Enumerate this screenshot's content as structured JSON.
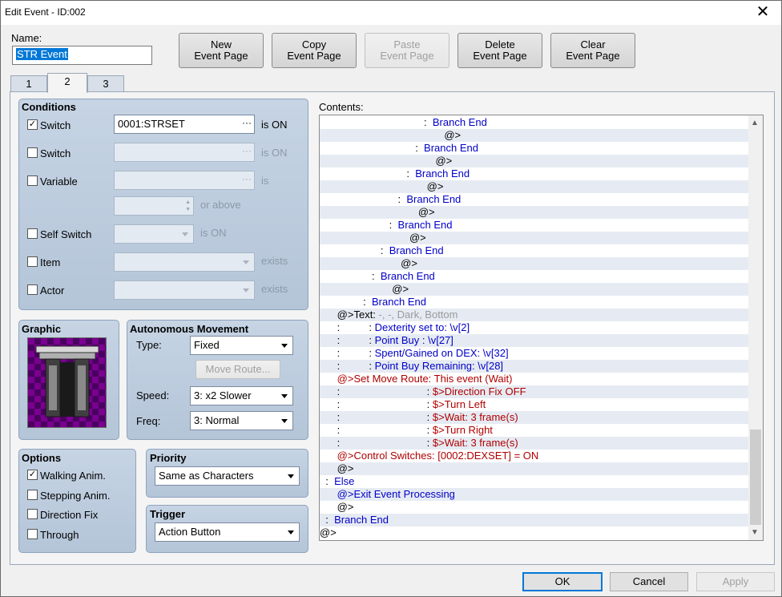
{
  "window": {
    "title": "Edit Event - ID:002",
    "close_glyph": "✕"
  },
  "name": {
    "label": "Name:",
    "value": "STR Event"
  },
  "toolbar": {
    "new_page_1": "New",
    "new_page_2": "Event Page",
    "copy_page_1": "Copy",
    "copy_page_2": "Event Page",
    "paste_page_1": "Paste",
    "paste_page_2": "Event Page",
    "delete_page_1": "Delete",
    "delete_page_2": "Event Page",
    "clear_page_1": "Clear",
    "clear_page_2": "Event Page"
  },
  "tabs": [
    {
      "label": "1"
    },
    {
      "label": "2"
    },
    {
      "label": "3"
    }
  ],
  "conditions": {
    "title": "Conditions",
    "switch1": {
      "label": "Switch",
      "checked": true,
      "value": "0001:STRSET",
      "suffix": "is ON"
    },
    "switch2": {
      "label": "Switch",
      "checked": false,
      "value": "",
      "suffix": "is ON"
    },
    "variable": {
      "label": "Variable",
      "checked": false,
      "value": "",
      "suffix": "is",
      "or_above": "or above"
    },
    "self_switch": {
      "label": "Self Switch",
      "checked": false,
      "suffix": "is ON"
    },
    "item": {
      "label": "Item",
      "checked": false,
      "suffix": "exists"
    },
    "actor": {
      "label": "Actor",
      "checked": false,
      "suffix": "exists"
    }
  },
  "graphic": {
    "title": "Graphic"
  },
  "autonomous": {
    "title": "Autonomous Movement",
    "type_label": "Type:",
    "type_value": "Fixed",
    "move_route": "Move Route...",
    "speed_label": "Speed:",
    "speed_value": "3: x2 Slower",
    "freq_label": "Freq:",
    "freq_value": "3: Normal"
  },
  "options": {
    "title": "Options",
    "walking": {
      "label": "Walking Anim.",
      "checked": true
    },
    "stepping": {
      "label": "Stepping Anim.",
      "checked": false
    },
    "direction_fix": {
      "label": "Direction Fix",
      "checked": false
    },
    "through": {
      "label": "Through",
      "checked": false
    }
  },
  "priority": {
    "title": "Priority",
    "value": "Same as Characters"
  },
  "trigger": {
    "title": "Trigger",
    "value": "Action Button"
  },
  "contents": {
    "label": "Contents:",
    "lines": [
      {
        "indent": "                                    :  ",
        "text": "Branch End",
        "color": "blue"
      },
      {
        "indent": "                                           ",
        "text": "@>",
        "color": "black"
      },
      {
        "indent": "                                 :  ",
        "text": "Branch End",
        "color": "blue"
      },
      {
        "indent": "                                        ",
        "text": "@>",
        "color": "black"
      },
      {
        "indent": "                              :  ",
        "text": "Branch End",
        "color": "blue"
      },
      {
        "indent": "                                     ",
        "text": "@>",
        "color": "black"
      },
      {
        "indent": "                           :  ",
        "text": "Branch End",
        "color": "blue"
      },
      {
        "indent": "                                  ",
        "text": "@>",
        "color": "black"
      },
      {
        "indent": "                        :  ",
        "text": "Branch End",
        "color": "blue"
      },
      {
        "indent": "                               ",
        "text": "@>",
        "color": "black"
      },
      {
        "indent": "                     :  ",
        "text": "Branch End",
        "color": "blue"
      },
      {
        "indent": "                            ",
        "text": "@>",
        "color": "black"
      },
      {
        "indent": "                  :  ",
        "text": "Branch End",
        "color": "blue"
      },
      {
        "indent": "                         ",
        "text": "@>",
        "color": "black"
      },
      {
        "indent": "               :  ",
        "text": "Branch End",
        "color": "blue"
      },
      {
        "indent": "      ",
        "text": "@>Text: ",
        "color": "black",
        "extra": "-, -, Dark, Bottom",
        "extra_color": "grey"
      },
      {
        "indent": "      :          : ",
        "text": "Dexterity set to: \\v[2]",
        "color": "blue"
      },
      {
        "indent": "      :          : ",
        "text": "Point Buy : \\v[27]",
        "color": "blue"
      },
      {
        "indent": "      :          : ",
        "text": "Spent/Gained on DEX: \\v[32]",
        "color": "blue"
      },
      {
        "indent": "      :          : ",
        "text": "Point Buy Remaining: \\v[28]",
        "color": "blue"
      },
      {
        "indent": "      ",
        "text": "@>Set Move Route: This event (Wait)",
        "color": "red"
      },
      {
        "indent": "      :                              : ",
        "text": "$>Direction Fix OFF",
        "color": "red"
      },
      {
        "indent": "      :                              : ",
        "text": "$>Turn Left",
        "color": "red"
      },
      {
        "indent": "      :                              : ",
        "text": "$>Wait: 3 frame(s)",
        "color": "red"
      },
      {
        "indent": "      :                              : ",
        "text": "$>Turn Right",
        "color": "red"
      },
      {
        "indent": "      :                              : ",
        "text": "$>Wait: 3 frame(s)",
        "color": "red"
      },
      {
        "indent": "      ",
        "text": "@>Control Switches: [0002:DEXSET] = ON",
        "color": "red"
      },
      {
        "indent": "      ",
        "text": "@>",
        "color": "black"
      },
      {
        "indent": "  :  ",
        "text": "Else",
        "color": "blue"
      },
      {
        "indent": "      ",
        "text": "@>Exit Event Processing",
        "color": "blue"
      },
      {
        "indent": "      ",
        "text": "@>",
        "color": "black"
      },
      {
        "indent": "  :  ",
        "text": "Branch End",
        "color": "blue"
      },
      {
        "indent": "",
        "text": "@>",
        "color": "black"
      }
    ]
  },
  "footer": {
    "ok": "OK",
    "cancel": "Cancel",
    "apply": "Apply"
  },
  "icons": {
    "close": "close-icon",
    "ellipsis": "ellipsis-icon",
    "dropdown": "chevron-down-icon",
    "scroll_up": "scroll-up-icon",
    "scroll_down": "scroll-down-icon"
  }
}
